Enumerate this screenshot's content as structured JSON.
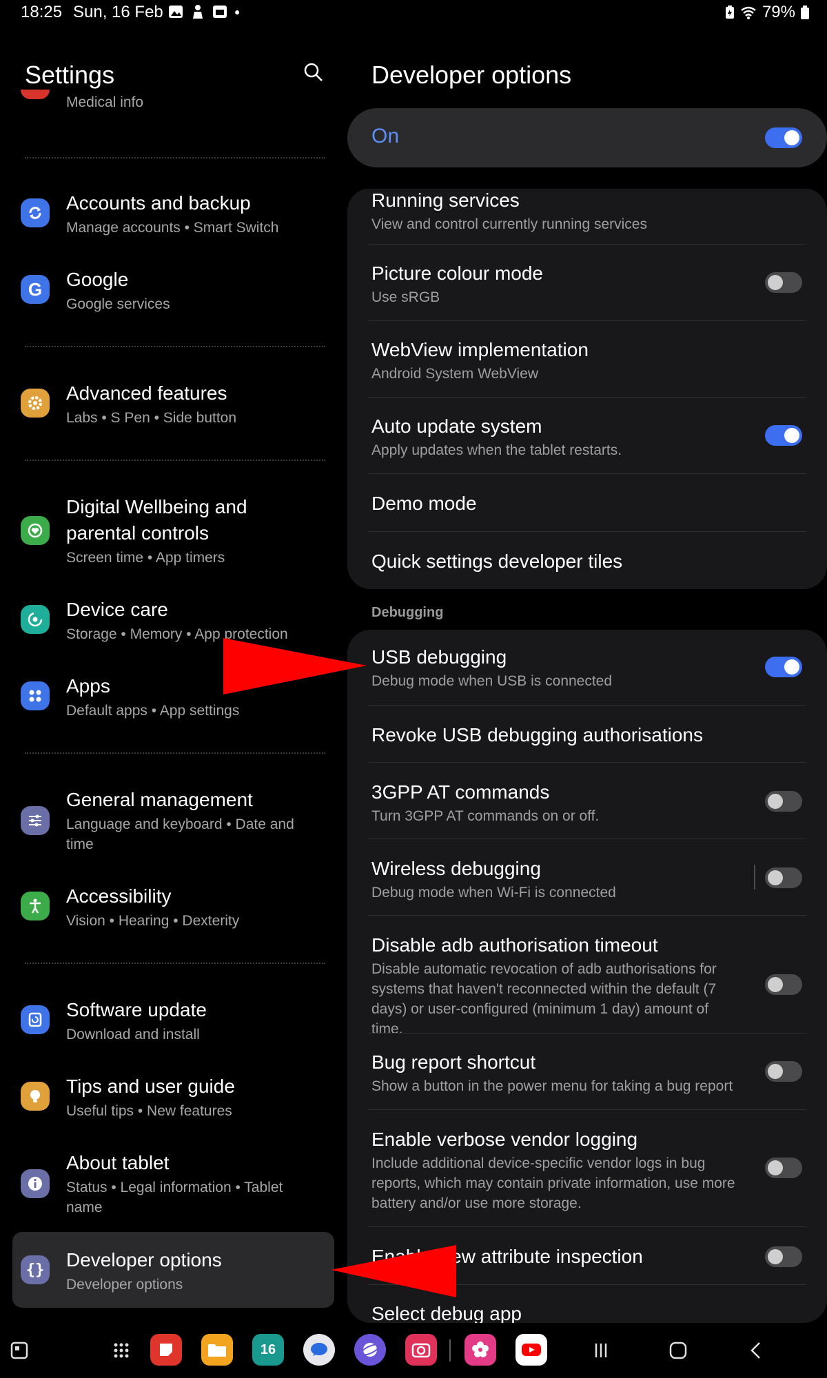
{
  "status_bar": {
    "time": "18:25",
    "date": "Sun, 16 Feb",
    "battery": "79%"
  },
  "left_pane": {
    "title": "Settings",
    "items": [
      {
        "title": "",
        "subtitle": "Medical info",
        "icon": "medical-icon",
        "color": "#d9342b"
      },
      {
        "title": "Accounts and backup",
        "subtitle": "Manage accounts • Smart Switch",
        "icon": "sync-icon",
        "color": "#3f73e8"
      },
      {
        "title": "Google",
        "subtitle": "Google services",
        "icon": "google-icon",
        "color": "#3f73e8"
      },
      {
        "title": "Advanced features",
        "subtitle": "Labs • S Pen • Side button",
        "icon": "gear-plus-icon",
        "color": "#e0a13a"
      },
      {
        "title": "Digital Wellbeing and parental controls",
        "subtitle": "Screen time • App timers",
        "icon": "wellbeing-icon",
        "color": "#3cab4a"
      },
      {
        "title": "Device care",
        "subtitle": "Storage • Memory • App protection",
        "icon": "device-care-icon",
        "color": "#1fae9a"
      },
      {
        "title": "Apps",
        "subtitle": "Default apps • App settings",
        "icon": "apps-grid-icon",
        "color": "#3f73e8"
      },
      {
        "title": "General management",
        "subtitle": "Language and keyboard • Date and time",
        "icon": "sliders-icon",
        "color": "#6a6fa8"
      },
      {
        "title": "Accessibility",
        "subtitle": "Vision • Hearing • Dexterity",
        "icon": "accessibility-icon",
        "color": "#3cab4a"
      },
      {
        "title": "Software update",
        "subtitle": "Download and install",
        "icon": "software-update-icon",
        "color": "#3f73e8"
      },
      {
        "title": "Tips and user guide",
        "subtitle": "Useful tips • New features",
        "icon": "lightbulb-icon",
        "color": "#e0a13a"
      },
      {
        "title": "About tablet",
        "subtitle": "Status • Legal information • Tablet name",
        "icon": "info-icon",
        "color": "#6a6fa8"
      },
      {
        "title": "Developer options",
        "subtitle": "Developer options",
        "icon": "braces-icon",
        "color": "#6a6fa8"
      }
    ]
  },
  "right_pane": {
    "title": "Developer options",
    "master_label": "On",
    "group1": [
      {
        "title": "Running services",
        "subtitle": "View and control currently running services"
      },
      {
        "title": "Picture colour mode",
        "subtitle": "Use sRGB",
        "toggle": "off"
      },
      {
        "title": "WebView implementation",
        "subtitle": "Android System WebView"
      },
      {
        "title": "Auto update system",
        "subtitle": "Apply updates when the tablet restarts.",
        "toggle": "on"
      },
      {
        "title": "Demo mode",
        "subtitle": ""
      },
      {
        "title": "Quick settings developer tiles",
        "subtitle": ""
      }
    ],
    "section_label": "Debugging",
    "group2": [
      {
        "title": "USB debugging",
        "subtitle": "Debug mode when USB is connected",
        "toggle": "on"
      },
      {
        "title": "Revoke USB debugging authorisations",
        "subtitle": ""
      },
      {
        "title": "3GPP AT commands",
        "subtitle": "Turn 3GPP AT commands on or off.",
        "toggle": "off"
      },
      {
        "title": "Wireless debugging",
        "subtitle": "Debug mode when Wi-Fi is connected",
        "toggle": "off"
      },
      {
        "title": "Disable adb authorisation timeout",
        "subtitle": "Disable automatic revocation of adb authorisations for systems that haven't reconnected within the default (7 days) or user-configured (minimum 1 day) amount of time.",
        "toggle": "off"
      },
      {
        "title": "Bug report shortcut",
        "subtitle": "Show a button in the power menu for taking a bug report",
        "toggle": "off"
      },
      {
        "title": "Enable verbose vendor logging",
        "subtitle": "Include additional device-specific vendor logs in bug reports, which may contain private information, use more battery and/or use more storage.",
        "toggle": "off"
      },
      {
        "title": "Enable view attribute inspection",
        "subtitle": "",
        "toggle": "off"
      },
      {
        "title": "Select debug app",
        "subtitle": ""
      }
    ]
  },
  "navbar": {
    "apps": [
      {
        "name": "sticky-notes-app-icon",
        "color": "#e0352b"
      },
      {
        "name": "my-files-app-icon",
        "color": "#f2a41e"
      },
      {
        "name": "calendar-app-icon",
        "color": "#1a9a8f"
      },
      {
        "name": "messages-app-icon",
        "color": "#e8e8ec"
      },
      {
        "name": "internet-app-icon",
        "color": "#6a55d8"
      },
      {
        "name": "camera-app-icon",
        "color": "#e0315a"
      },
      {
        "name": "blossom-app-icon",
        "color": "#e33b86"
      },
      {
        "name": "youtube-app-icon",
        "color": "#ffffff"
      }
    ],
    "calendar_day": "16"
  }
}
